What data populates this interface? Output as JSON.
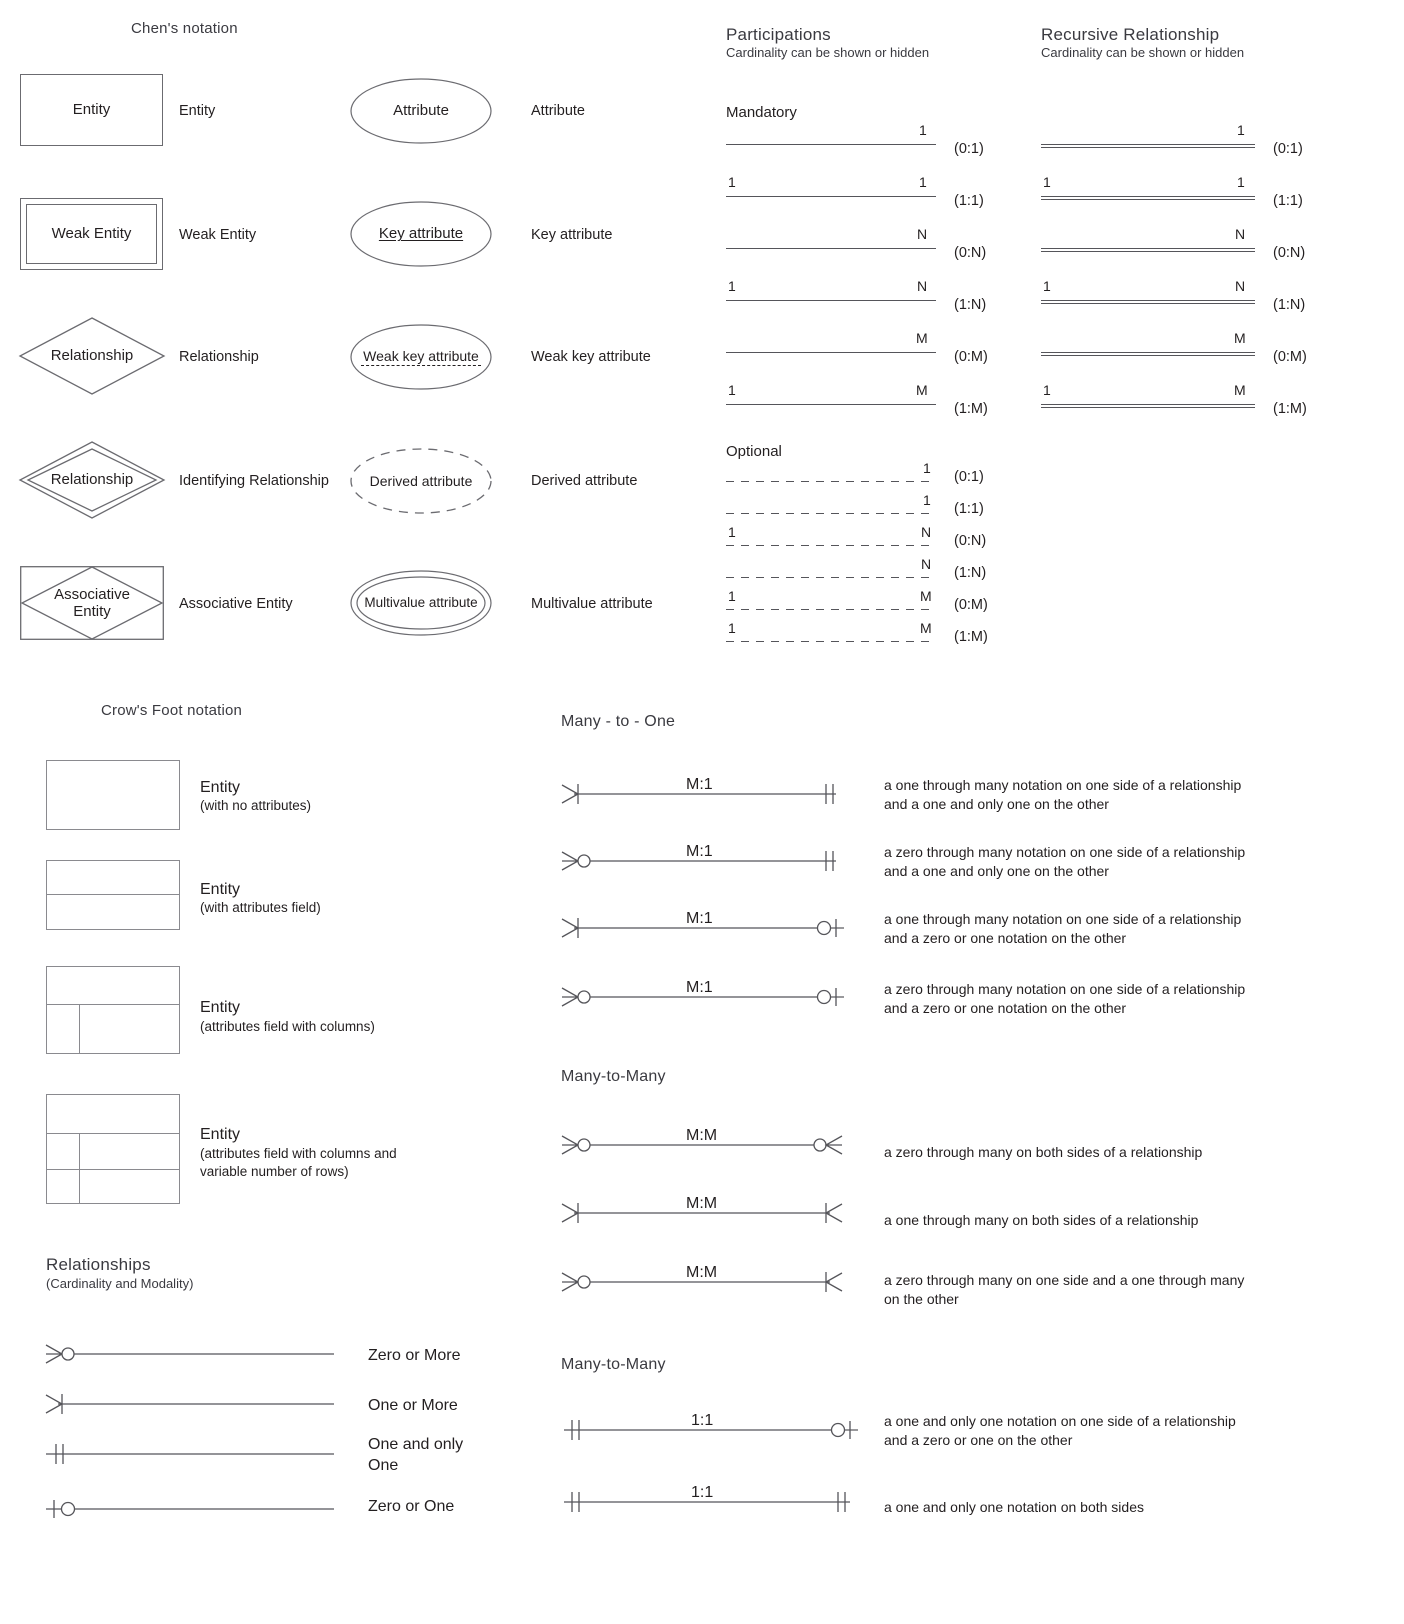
{
  "sections": {
    "chen": {
      "title": "Chen's notation"
    },
    "participations": {
      "title": "Participations",
      "subtitle": "Cardinality can be shown or hidden",
      "mandatory_label": "Mandatory",
      "optional_label": "Optional"
    },
    "recursive": {
      "title": "Recursive Relationship",
      "subtitle": "Cardinality can be shown or hidden"
    },
    "crowsfoot": {
      "title": "Crow's Foot notation"
    },
    "relationships": {
      "title": "Relationships",
      "subtitle": "(Cardinality and Modality)"
    },
    "many_to_one": {
      "title": "Many - to - One"
    },
    "many_to_many": {
      "title": "Many-to-Many"
    },
    "one_to_one": {
      "title": "Many-to-Many"
    }
  },
  "chen_left": [
    {
      "shape": "rectangle",
      "shape_text": "Entity",
      "label": "Entity"
    },
    {
      "shape": "double-rectangle",
      "shape_text": "Weak Entity",
      "label": "Weak Entity"
    },
    {
      "shape": "diamond",
      "shape_text": "Relationship",
      "label": "Relationship"
    },
    {
      "shape": "double-diamond",
      "shape_text": "Relationship",
      "label": "Identifying Relationship"
    },
    {
      "shape": "diamond-in-rect",
      "shape_text": "Associative\nEntity",
      "label": "Associative Entity"
    }
  ],
  "chen_right": [
    {
      "shape": "ellipse",
      "shape_text": "Attribute",
      "label": "Attribute"
    },
    {
      "shape": "ellipse-underline",
      "shape_text": "Key attribute",
      "label": "Key attribute"
    },
    {
      "shape": "ellipse-dash-under",
      "shape_text": "Weak key attribute",
      "label": "Weak key attribute"
    },
    {
      "shape": "ellipse-dashed",
      "shape_text": "Derived attribute",
      "label": "Derived attribute"
    },
    {
      "shape": "double-ellipse",
      "shape_text": "Multivalue attribute",
      "label": "Multivalue attribute"
    }
  ],
  "participations_mandatory": [
    {
      "left": "",
      "right": "1",
      "card": "(0:1)"
    },
    {
      "left": "1",
      "right": "1",
      "card": "(1:1)"
    },
    {
      "left": "",
      "right": "N",
      "card": "(0:N)"
    },
    {
      "left": "1",
      "right": "N",
      "card": "(1:N)"
    },
    {
      "left": "",
      "right": "M",
      "card": "(0:M)"
    },
    {
      "left": "1",
      "right": "M",
      "card": "(1:M)"
    }
  ],
  "participations_optional": [
    {
      "left": "",
      "right": "1",
      "card": "(0:1)"
    },
    {
      "left": "",
      "right": "1",
      "card": "(1:1)"
    },
    {
      "left": "1",
      "right": "N",
      "card": "(0:N)"
    },
    {
      "left": "",
      "right": "N",
      "card": "(1:N)"
    },
    {
      "left": "1",
      "right": "M",
      "card": "(0:M)"
    },
    {
      "left": "1",
      "right": "M",
      "card": "(1:M)"
    }
  ],
  "recursive_rows": [
    {
      "left": "",
      "right": "1",
      "card": "(0:1)"
    },
    {
      "left": "1",
      "right": "1",
      "card": "(1:1)"
    },
    {
      "left": "",
      "right": "N",
      "card": "(0:N)"
    },
    {
      "left": "1",
      "right": "N",
      "card": "(1:N)"
    },
    {
      "left": "",
      "right": "M",
      "card": "(0:M)"
    },
    {
      "left": "1",
      "right": "M",
      "card": "(1:M)"
    }
  ],
  "crowsfoot_entities": [
    {
      "title": "Entity",
      "sub": "(with no attributes)",
      "rows": 1,
      "cols": false
    },
    {
      "title": "Entity",
      "sub": "(with attributes field)",
      "rows": 2,
      "cols": false
    },
    {
      "title": "Entity",
      "sub": "(attributes field with columns)",
      "rows": 2,
      "cols": true
    },
    {
      "title": "Entity",
      "sub": "(attributes field with columns and\nvariable number of rows)",
      "rows": 3,
      "cols": true
    }
  ],
  "relationship_symbols": [
    {
      "end": "crowfoot-circle",
      "label": "Zero or More"
    },
    {
      "end": "crowfoot-bar",
      "label": "One or More"
    },
    {
      "end": "double-bar",
      "label": "One and only\nOne"
    },
    {
      "end": "bar-circle",
      "label": "Zero or One"
    }
  ],
  "many_to_one_rows": [
    {
      "cardinality": "M:1",
      "left_end": "crowfoot-bar",
      "right_end": "double-bar",
      "desc": "a one through many notation on one side of a relationship\nand a one and only one on the other"
    },
    {
      "cardinality": "M:1",
      "left_end": "crowfoot-circle",
      "right_end": "double-bar",
      "desc": "a zero through many notation on one side of a relationship\nand a one and only one on the other"
    },
    {
      "cardinality": "M:1",
      "left_end": "crowfoot-bar",
      "right_end": "circle-bar",
      "desc": "a one through many notation on one side of a relationship\nand a zero or one notation on the other"
    },
    {
      "cardinality": "M:1",
      "left_end": "crowfoot-circle",
      "right_end": "circle-bar",
      "desc": "a zero through many notation on one side of a relationship\nand a zero or one notation on the other"
    }
  ],
  "many_to_many_rows": [
    {
      "cardinality": "M:M",
      "left_end": "crowfoot-circle",
      "right_end": "circle-crowfoot",
      "desc": "a zero through many on both sides of a relationship"
    },
    {
      "cardinality": "M:M",
      "left_end": "crowfoot-bar",
      "right_end": "crowfoot-r",
      "desc": "a one through many on both sides of a relationship"
    },
    {
      "cardinality": "M:M",
      "left_end": "crowfoot-circle",
      "right_end": "crowfoot-r",
      "desc": "a zero through many on one side and a one through many\non the other"
    }
  ],
  "one_to_one_rows": [
    {
      "cardinality": "1:1",
      "left_end": "double-bar",
      "right_end": "circle-bar",
      "desc": "a one and only one notation on one side of a relationship\nand a zero or one on the other"
    },
    {
      "cardinality": "1:1",
      "left_end": "double-bar",
      "right_end": "double-bar",
      "desc": "a one and only one notation on both sides"
    }
  ],
  "colors": {
    "stroke": "#6b6b70",
    "line": "#55555a",
    "text": "#231f20",
    "heading": "#3a3a40",
    "box": "#8a8a8f"
  }
}
